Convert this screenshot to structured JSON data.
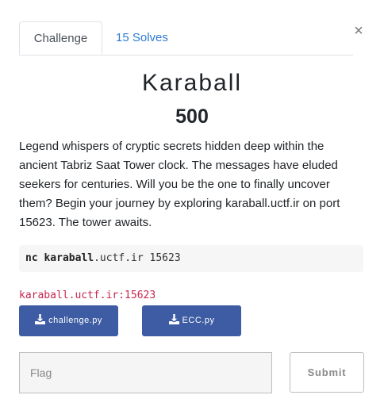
{
  "tabs": [
    {
      "label": "Challenge",
      "active": true
    },
    {
      "label": "15 Solves",
      "active": false
    }
  ],
  "close_label": "×",
  "challenge": {
    "name": "Karaball",
    "points": "500",
    "description": "Legend whispers of cryptic secrets hidden deep within the ancient Tabriz Saat Tower clock. The messages have eluded seekers for centuries. Will you be the one to finally uncover them? Begin your journey by exploring karaball.uctf.ir on port 15623. The tower awaits.",
    "command_bold": "nc karaball",
    "command_rest": ".uctf.ir 15623",
    "connection_info": "karaball.uctf.ir:15623"
  },
  "files": [
    {
      "label": "challenge.py",
      "icon": "download-icon"
    },
    {
      "label": "ECC.py",
      "icon": "download-icon"
    }
  ],
  "flag_form": {
    "placeholder": "Flag",
    "value": "",
    "submit_label": "Submit"
  },
  "colors": {
    "file_button": "#3d5ca3",
    "tab_link": "#2f7bd1",
    "connection_text": "#c7254e"
  }
}
